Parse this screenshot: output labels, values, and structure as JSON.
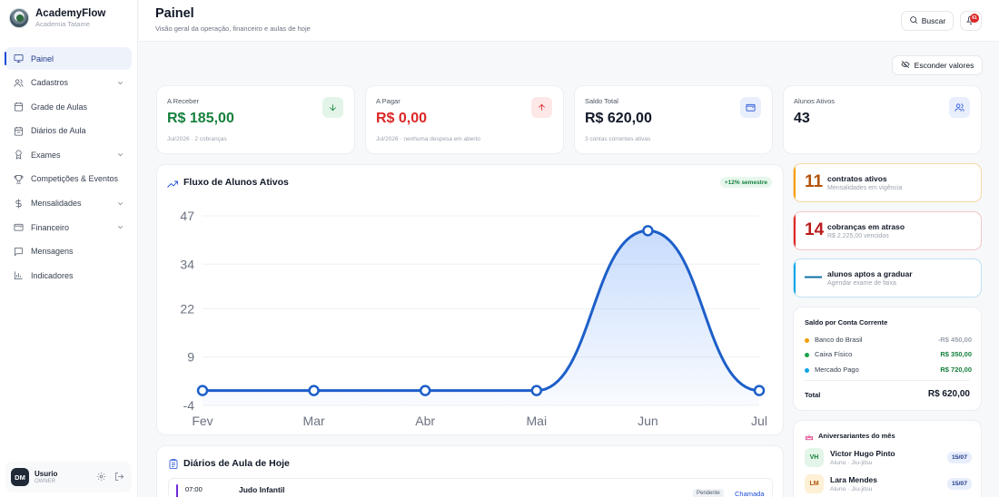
{
  "brand": {
    "name": "AcademyFlow",
    "subtitle": "Academia Tatame"
  },
  "sidebar": {
    "items": [
      {
        "label": "Painel",
        "icon": "monitor-icon",
        "active": true,
        "expandable": false
      },
      {
        "label": "Cadastros",
        "icon": "users-icon",
        "active": false,
        "expandable": true
      },
      {
        "label": "Grade de Aulas",
        "icon": "calendar-icon",
        "active": false,
        "expandable": false
      },
      {
        "label": "Diários de Aula",
        "icon": "calendar-check-icon",
        "active": false,
        "expandable": false
      },
      {
        "label": "Exames",
        "icon": "award-icon",
        "active": false,
        "expandable": true
      },
      {
        "label": "Competições & Eventos",
        "icon": "trophy-icon",
        "active": false,
        "expandable": false
      },
      {
        "label": "Mensalidades",
        "icon": "dollar-icon",
        "active": false,
        "expandable": true
      },
      {
        "label": "Financeiro",
        "icon": "wallet-icon",
        "active": false,
        "expandable": true
      },
      {
        "label": "Mensagens",
        "icon": "message-icon",
        "active": false,
        "expandable": false
      },
      {
        "label": "Indicadores",
        "icon": "bar-chart-icon",
        "active": false,
        "expandable": false
      }
    ]
  },
  "user": {
    "initials": "DM",
    "name": "Usurio",
    "role": "OWNER"
  },
  "header": {
    "title": "Painel",
    "subtitle": "Visão geral da operação, financeiro e aulas de hoje",
    "search_label": "Buscar",
    "notification_count": "61"
  },
  "hide_values_label": "Esconder valores",
  "stats": [
    {
      "label": "A Receber",
      "value": "R$ 185,00",
      "foot": "Jul/2026 · 2 cobranças",
      "color": "#15803d",
      "icon": "arrow-down-icon",
      "icon_bg": "#e3f5e8",
      "icon_color": "#15803d"
    },
    {
      "label": "A Pagar",
      "value": "R$ 0,00",
      "foot": "Jul/2026 · nenhuma despesa em aberto",
      "color": "#dc2626",
      "icon": "arrow-up-icon",
      "icon_bg": "#fde7e7",
      "icon_color": "#dc2626"
    },
    {
      "label": "Saldo Total",
      "value": "R$ 620,00",
      "foot": "3 contas correntes ativas",
      "color": "#111827",
      "icon": "wallet-icon",
      "icon_bg": "#e8eefc",
      "icon_color": "#1d4ed8"
    },
    {
      "label": "Alunos Ativos",
      "value": "43",
      "foot": "",
      "color": "#111827",
      "icon": "users-icon",
      "icon_bg": "#e8eefc",
      "icon_color": "#1d4ed8"
    }
  ],
  "chart": {
    "title": "Fluxo de Alunos Ativos",
    "badge": "+12% semestre"
  },
  "chart_data": {
    "type": "line",
    "title": "Fluxo de Alunos Ativos",
    "categories": [
      "Fev",
      "Mar",
      "Abr",
      "Mai",
      "Jun",
      "Jul"
    ],
    "values": [
      0,
      0,
      0,
      0,
      43,
      0
    ],
    "yticks": [
      47,
      34,
      22,
      9,
      -4
    ],
    "ylim": [
      -4,
      47
    ],
    "grid": true,
    "smooth": true,
    "color": "#1d5fc9"
  },
  "diarios": {
    "title": "Diários de Aula de Hoje",
    "rows": [
      {
        "time": "07:00",
        "name": "Judo Infantil",
        "status": "Pendente",
        "action": "Chamada"
      }
    ]
  },
  "alerts": [
    {
      "num": "11",
      "title": "contratos ativos",
      "sub": "Mensalidades em vigência",
      "color": "#b45309",
      "variant": "orange"
    },
    {
      "num": "14",
      "title": "cobranças em atraso",
      "sub": "R$ 2.225,00 vencidos",
      "color": "#b91c1c",
      "variant": "red"
    },
    {
      "num": "—",
      "title": "alunos aptos a graduar",
      "sub": "Agendar exame de faixa",
      "color": "#0369a1",
      "variant": "blue"
    }
  ],
  "saldo": {
    "title": "Saldo por Conta Corrente",
    "rows": [
      {
        "name": "Banco do Brasil",
        "value": "-R$ 450,00",
        "dot": "#f59e0b",
        "color": "#9ca3af"
      },
      {
        "name": "Caixa Físico",
        "value": "R$ 350,00",
        "dot": "#16a34a",
        "color": "#15803d"
      },
      {
        "name": "Mercado Pago",
        "value": "R$ 720,00",
        "dot": "#0ea5e9",
        "color": "#15803d"
      }
    ],
    "total_label": "Total",
    "total_value": "R$ 620,00"
  },
  "aniversariantes": {
    "title": "Aniversariantes do mês",
    "rows": [
      {
        "initials": "VH",
        "name": "Victor Hugo Pinto",
        "sub": "Aluno · Jiu-jitsu",
        "date": "15/07",
        "bg": "#e3f5e8",
        "fg": "#15803d"
      },
      {
        "initials": "LM",
        "name": "Lara Mendes",
        "sub": "Aluno · Jiu-jitsu",
        "date": "15/07",
        "bg": "#fdf0d5",
        "fg": "#b45309"
      }
    ]
  }
}
